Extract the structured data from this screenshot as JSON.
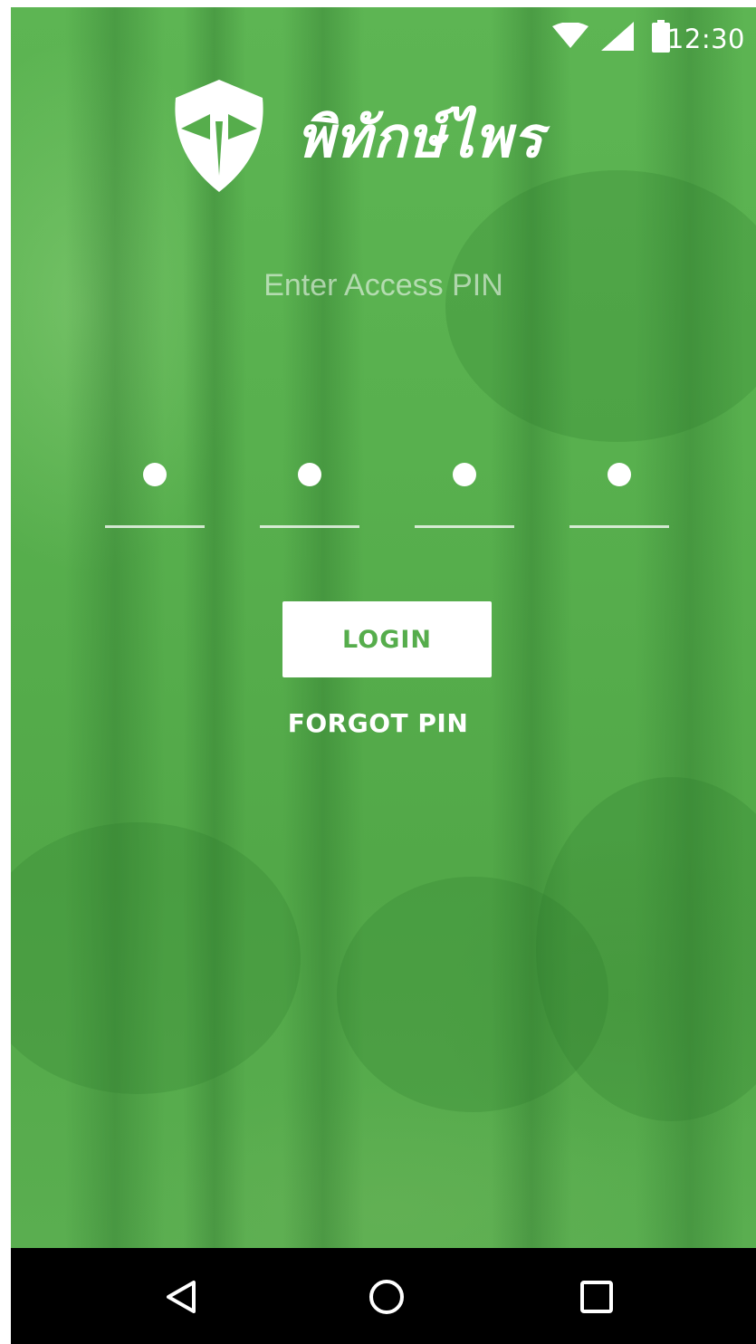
{
  "status_bar": {
    "time": "12:30",
    "icons": [
      "wifi-icon",
      "signal-icon",
      "battery-icon"
    ]
  },
  "app": {
    "brand_name": "พิทักษ์ไพร",
    "logo_icon": "shield-icon"
  },
  "login": {
    "pin_prompt": "Enter Access PIN",
    "pin_digits": [
      "•",
      "•",
      "•",
      "•"
    ],
    "login_label": "LOGIN",
    "forgot_label": "FORGOT PIN"
  },
  "nav_bar": {
    "buttons": [
      "back-icon",
      "home-icon",
      "recents-icon"
    ]
  },
  "colors": {
    "primary_green": "#56ad4c",
    "text_white": "#ffffff",
    "nav_background": "#000000"
  }
}
